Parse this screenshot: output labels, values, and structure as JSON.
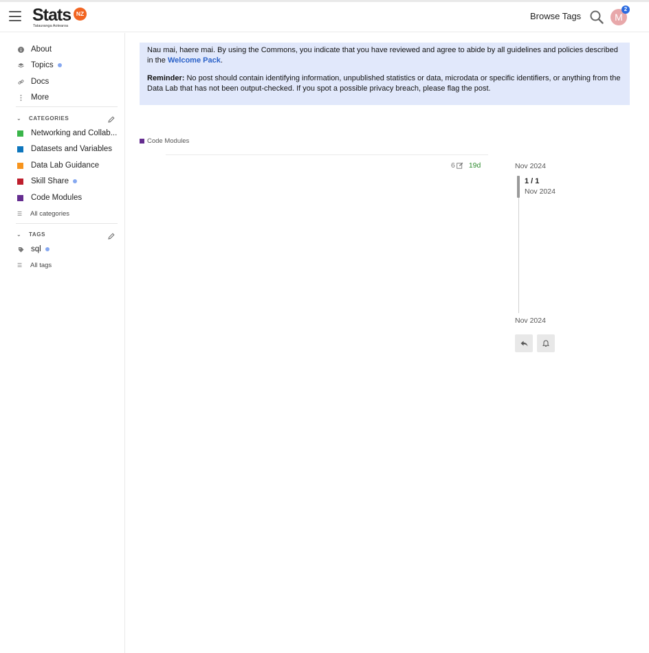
{
  "header": {
    "logo_word": "Stats",
    "logo_badge": "NZ",
    "logo_subtitle": "Tatauranga Aotearoa",
    "browse_tags": "Browse Tags",
    "avatar_letter": "M",
    "notification_count": "2"
  },
  "sidebar": {
    "nav": [
      {
        "label": "About",
        "icon": "info-icon"
      },
      {
        "label": "Topics",
        "icon": "layers-icon",
        "unread": true
      },
      {
        "label": "Docs",
        "icon": "link-icon"
      },
      {
        "label": "More",
        "icon": "vertical-ellipsis-icon"
      }
    ],
    "categories_heading": "CATEGORIES",
    "categories": [
      {
        "label": "Networking and Collab...",
        "color": "#3ab54a"
      },
      {
        "label": "Datasets and Variables",
        "color": "#0e76bd"
      },
      {
        "label": "Data Lab Guidance",
        "color": "#f7941d"
      },
      {
        "label": "Skill Share",
        "color": "#be1e2d",
        "unread": true
      },
      {
        "label": "Code Modules",
        "color": "#652d90"
      }
    ],
    "all_categories": "All categories",
    "tags_heading": "TAGS",
    "tags": [
      {
        "label": "sql",
        "unread": true
      }
    ],
    "all_tags": "All tags"
  },
  "banner": {
    "line1_text": "Nau mai, haere mai. By using the Commons, you indicate that you have reviewed and agree to abide by all guidelines and policies described in the ",
    "line1_link": "Welcome Pack",
    "line1_end": ".",
    "reminder_label": "Reminder:",
    "reminder_text": " No post should contain identifying information, unpublished statistics or data, microdata or specific identifiers, or anything from the Data Lab that has not been output-checked. If you spot a possible privacy breach, please flag the post.",
    "background": "#e1e8fb"
  },
  "topic": {
    "category": "Code Modules",
    "category_color": "#652d90",
    "edit_count": "6",
    "age": "19d"
  },
  "timeline": {
    "start_date": "Nov 2024",
    "position": "1 / 1",
    "position_date": "Nov 2024",
    "end_date": "Nov 2024"
  }
}
